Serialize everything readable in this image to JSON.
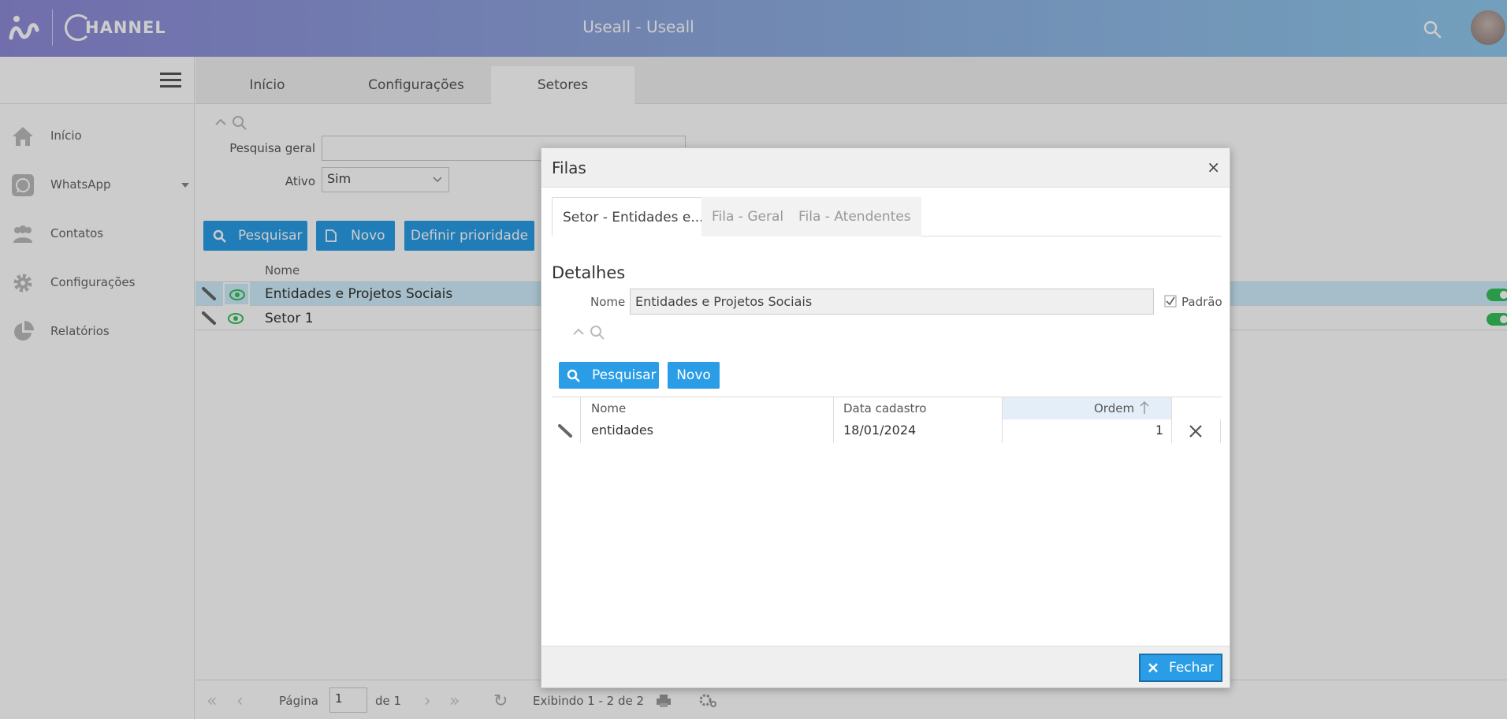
{
  "app_title": "Useall - Useall",
  "brand": {
    "logo_text": "HANNEL"
  },
  "colors": {
    "accent": "#2a9de6",
    "toggle_on": "#35c05a",
    "selected_row": "#cfeefc"
  },
  "sidebar": {
    "items": [
      {
        "label": "Início",
        "icon": "home-icon"
      },
      {
        "label": "WhatsApp",
        "icon": "whatsapp-icon"
      },
      {
        "label": "Contatos",
        "icon": "contacts-icon"
      },
      {
        "label": "Configurações",
        "icon": "gear-icon"
      },
      {
        "label": "Relatórios",
        "icon": "pie-chart-icon"
      }
    ]
  },
  "tabs": [
    {
      "label": "Início"
    },
    {
      "label": "Configurações"
    },
    {
      "label": "Setores",
      "active": true
    }
  ],
  "filters": {
    "search_label": "Pesquisa geral",
    "search_value": "",
    "ativo_label": "Ativo",
    "ativo_value": "Sim"
  },
  "toolbar": {
    "search_label": "Pesquisar",
    "new_label": "Novo",
    "priority_label": "Definir prioridade"
  },
  "grid": {
    "header_name": "Nome",
    "rows": [
      {
        "name": "Entidades e Projetos Sociais",
        "selected": true,
        "active": true
      },
      {
        "name": "Setor 1",
        "selected": false,
        "active": true
      }
    ]
  },
  "pager": {
    "page_label": "Página",
    "page_value": "1",
    "of_label": "de 1",
    "showing": "Exibindo 1 - 2 de 2"
  },
  "modal": {
    "title": "Filas",
    "close_glyph": "×",
    "tabs": [
      {
        "label": "Setor - Entidades e...",
        "active": true
      },
      {
        "label": "Fila - Geral"
      },
      {
        "label": "Fila - Atendentes"
      }
    ],
    "section_title": "Detalhes",
    "name_label": "Nome",
    "name_value": "Entidades e Projetos Sociais",
    "padrao_label": "Padrão",
    "padrao_checked": true,
    "search_label": "Pesquisar",
    "new_label": "Novo",
    "grid": {
      "headers": {
        "name": "Nome",
        "date": "Data cadastro",
        "order": "Ordem"
      },
      "rows": [
        {
          "name": "entidades",
          "date": "18/01/2024",
          "order": "1"
        }
      ]
    },
    "close_button_label": "Fechar"
  }
}
